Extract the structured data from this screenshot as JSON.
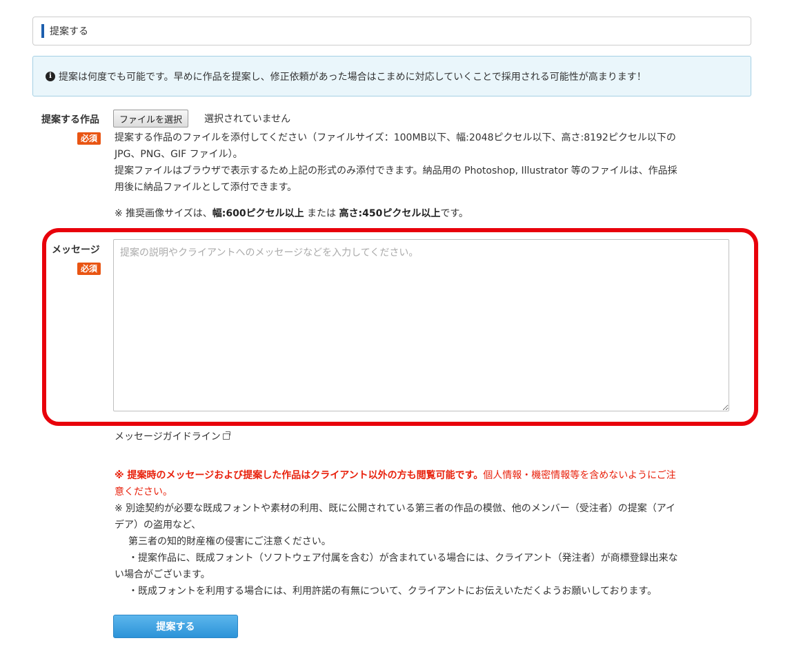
{
  "section": {
    "title": "提案する"
  },
  "info": {
    "text": "提案は何度でも可能です。早めに作品を提案し、修正依頼があった場合はこまめに対応していくことで採用される可能性が高まります！"
  },
  "file_field": {
    "label": "提案する作品",
    "required": "必須",
    "button_label": "ファイルを選択",
    "status": "選択されていません",
    "help_lines": [
      "提案する作品のファイルを添付してください（ファイルサイズ：100MB以下、幅:2048ピクセル以下、高さ:8192ピクセル以下の",
      "JPG、PNG、GIF ファイル）。",
      "提案ファイルはブラウザで表示するため上記の形式のみ添付できます。納品用の Photoshop, Illustrator 等のファイルは、作品採",
      "用後に納品ファイルとして添付できます。"
    ],
    "note_prefix": "※ 推奨画像サイズは、",
    "note_width": "幅:600ピクセル以上",
    "note_or": " または ",
    "note_height": "高さ:450ピクセル以上",
    "note_suffix": "です。"
  },
  "message_field": {
    "label": "メッセージ",
    "required": "必須",
    "placeholder": "提案の説明やクライアントへのメッセージなどを入力してください。"
  },
  "guideline_link": "メッセージガイドライン",
  "warnings": {
    "red_bold": "※ 提案時のメッセージおよび提案した作品はクライアント以外の方も閲覧可能です。",
    "red_normal_1": "個人情報・機密情報等を含めないようにご注",
    "red_normal_2": "意ください。",
    "line1a": "※ 別途契約が必要な既成フォントや素材の利用、既に公開されている第三者の作品の模倣、他のメンバー（受注者）の提案（アイ",
    "line1b": "デア）の盗用など、",
    "line2": "第三者の知的財産権の侵害にご注意ください。",
    "line3a": "・提案作品に、既成フォント（ソフトウェア付属を含む）が含まれている場合には、クライアント（発注者）が商標登録出来な",
    "line3b": "い場合がございます。",
    "line4": "・既成フォントを利用する場合には、利用許諾の有無について、クライアントにお伝えいただくようお願いしております。"
  },
  "submit_label": "提案する",
  "colors": {
    "accent": "#1d5fae",
    "required": "#e95513",
    "warning": "#e8200b",
    "highlight": "#e8000b",
    "submit": "#2c93d8"
  }
}
